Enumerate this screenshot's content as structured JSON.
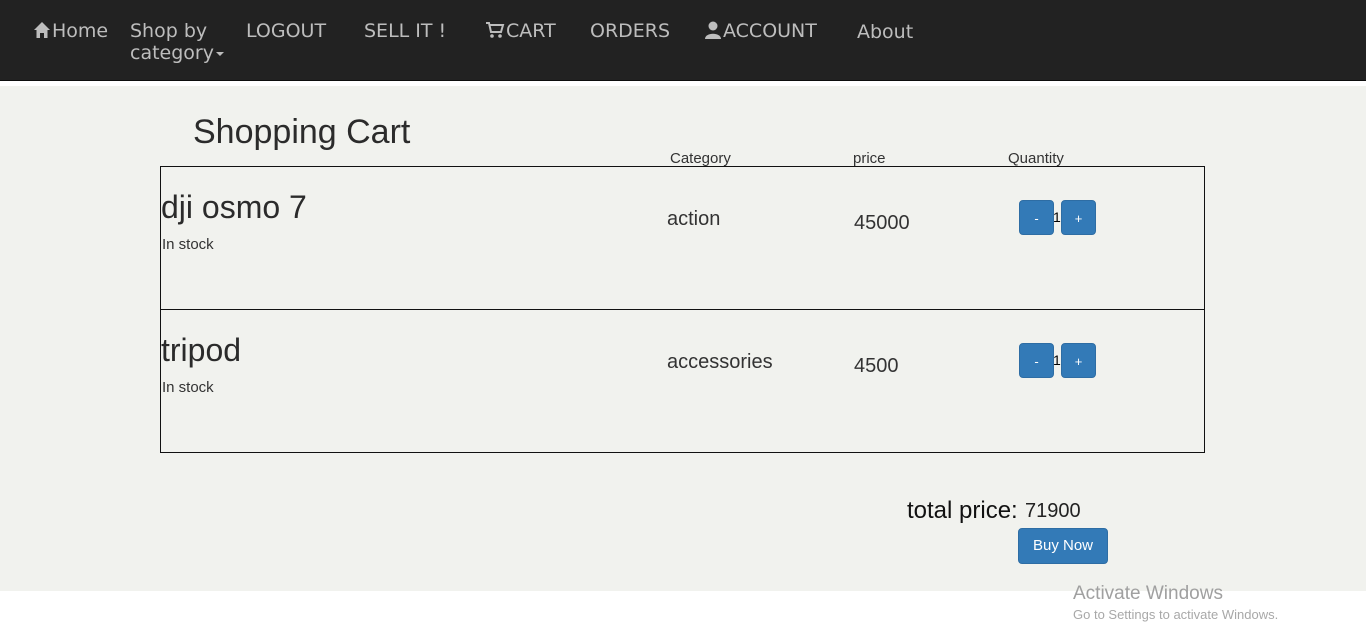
{
  "nav": {
    "home": "Home",
    "shop_line1": "Shop by",
    "shop_line2": "category",
    "logout": "LOGOUT",
    "sell": "SELL IT !",
    "cart": "CART",
    "orders": "ORDERS",
    "account": "ACCOUNT",
    "about": "About"
  },
  "page": {
    "title": "Shopping Cart",
    "columns": {
      "category": "Category",
      "price": "price",
      "quantity": "Quantity"
    }
  },
  "cart": {
    "items": [
      {
        "name": "dji osmo 7",
        "stock": "In stock",
        "category": "action",
        "price": "45000",
        "quantity": "1",
        "minus": "-",
        "plus": "+"
      },
      {
        "name": "tripod",
        "stock": "In stock",
        "category": "accessories",
        "price": "4500",
        "quantity": "1",
        "minus": "-",
        "plus": "+"
      }
    ],
    "total_label": "total price:",
    "total_value": "71900",
    "buy_label": "Buy Now"
  },
  "watermark": {
    "title": "Activate Windows",
    "subtitle": "Go to Settings to activate Windows."
  },
  "colors": {
    "navbar": "#222222",
    "content_bg": "#f1f2ee",
    "primary_button": "#337ab7"
  }
}
